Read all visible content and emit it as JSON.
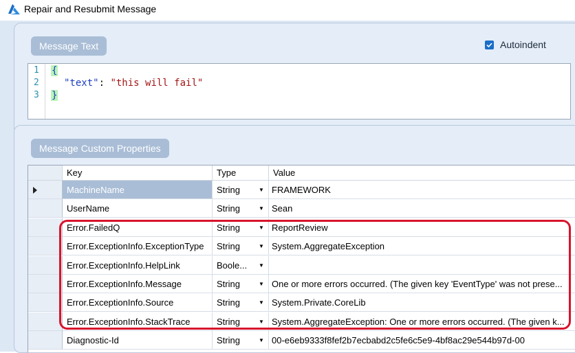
{
  "window": {
    "title": "Repair and Resubmit Message",
    "icon": "azure-logo-icon"
  },
  "message_text": {
    "group_label": "Message Text",
    "autoindent_label": "Autoindent",
    "autoindent_checked": true,
    "lines": [
      {
        "no": "1",
        "text": "{"
      },
      {
        "no": "2",
        "key": "\"text\"",
        "sep": ": ",
        "value": "\"this will fail\""
      },
      {
        "no": "3",
        "text": "}"
      }
    ]
  },
  "custom_props": {
    "group_label": "Message Custom Properties",
    "columns": {
      "key": "Key",
      "type": "Type",
      "value": "Value"
    },
    "rows": [
      {
        "key": "MachineName",
        "type": "String",
        "value": "FRAMEWORK",
        "current": true
      },
      {
        "key": "UserName",
        "type": "String",
        "value": "Sean"
      },
      {
        "key": "Error.FailedQ",
        "type": "String",
        "value": "ReportReview"
      },
      {
        "key": "Error.ExceptionInfo.ExceptionType",
        "type": "String",
        "value": "System.AggregateException"
      },
      {
        "key": "Error.ExceptionInfo.HelpLink",
        "type": "Boole...",
        "value": ""
      },
      {
        "key": "Error.ExceptionInfo.Message",
        "type": "String",
        "value": "One or more errors occurred. (The given key 'EventType' was not prese..."
      },
      {
        "key": "Error.ExceptionInfo.Source",
        "type": "String",
        "value": "System.Private.CoreLib"
      },
      {
        "key": "Error.ExceptionInfo.StackTrace",
        "type": "String",
        "value": "System.AggregateException: One or more errors occurred. (The given k..."
      },
      {
        "key": "Diagnostic-Id",
        "type": "String",
        "value": "00-e6eb9333f8fef2b7ecbabd2c5fe6c5e9-4bf8ac29e544b97d-00"
      }
    ]
  },
  "colors": {
    "highlight": "#d8142c",
    "accent": "#1a6ec9",
    "group_header": "#a9bdd6"
  }
}
